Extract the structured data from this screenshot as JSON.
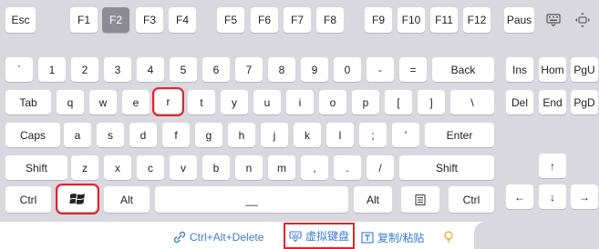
{
  "row_fn": [
    "Esc",
    "F1",
    "F2",
    "F3",
    "F4",
    "F5",
    "F6",
    "F7",
    "F8",
    "F9",
    "F10",
    "F11",
    "F12",
    "Paus"
  ],
  "row1": [
    "`",
    "1",
    "2",
    "3",
    "4",
    "5",
    "6",
    "7",
    "8",
    "9",
    "0",
    "-",
    "=",
    "Back"
  ],
  "row2": [
    "Tab",
    "q",
    "w",
    "e",
    "r",
    "t",
    "y",
    "u",
    "i",
    "o",
    "p",
    "[",
    "]",
    "\\"
  ],
  "row3": [
    "Caps",
    "a",
    "s",
    "d",
    "f",
    "g",
    "h",
    "j",
    "k",
    "l",
    ";",
    "'",
    "Enter"
  ],
  "row4": [
    "Shift",
    "z",
    "x",
    "c",
    "v",
    "b",
    "n",
    "m",
    ",",
    ".",
    "/",
    "Shift"
  ],
  "row5": {
    "ctrl_l": "Ctrl",
    "alt_l": "Alt",
    "space": "__",
    "alt_r": "Alt",
    "ctrl_r": "Ctrl"
  },
  "nav": {
    "ins": "Ins",
    "hom": "Hom",
    "pgu": "PgU",
    "del": "Del",
    "end": "End",
    "pgd": "PgD"
  },
  "arrows": {
    "up": "↑",
    "left": "←",
    "down": "↓",
    "right": "→"
  },
  "bottom": {
    "cad": "Ctrl+Alt+Delete",
    "vk": "虚拟键盘",
    "copy": "复制/粘贴"
  },
  "colors": {
    "accent": "#3a7bd5",
    "highlight": "#e0252b",
    "pressed": "#8c8c92"
  }
}
